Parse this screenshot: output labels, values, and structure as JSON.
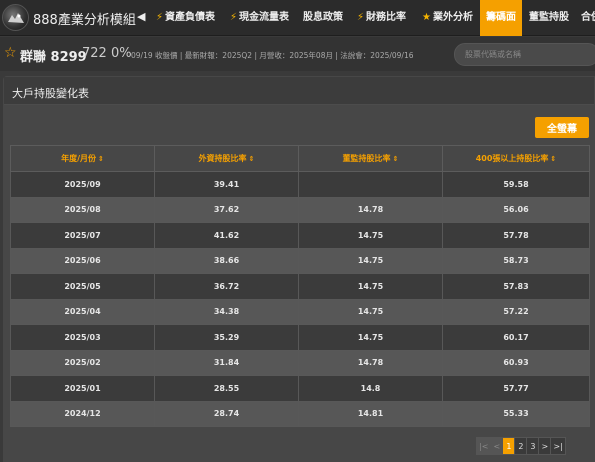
{
  "app": {
    "brand": "888產業分析模組"
  },
  "nav": {
    "arrow": "◀",
    "items": [
      {
        "label": "資產負債表",
        "bolt": true
      },
      {
        "label": "現金流量表",
        "bolt": true
      },
      {
        "label": "股息政策",
        "bolt": false
      },
      {
        "label": "財務比率",
        "bolt": true
      },
      {
        "label": "業外分析",
        "bolt": true,
        "star": true
      },
      {
        "label": "籌碼面",
        "bolt": false,
        "active": true
      },
      {
        "label": "董監持股",
        "bolt": false
      },
      {
        "label": "合併",
        "bolt": false
      }
    ]
  },
  "stock": {
    "name": "群聯 8299",
    "price": "722",
    "change": "0%",
    "meta": "09/19 收盤價 | 最新財報：2025Q2 | 月營收：2025年08月 | 法說會：2025/09/16",
    "search_placeholder": "股票代碼或名稱"
  },
  "panel": {
    "title": "大戶持股變化表",
    "fullscreen_label": "全螢幕"
  },
  "table": {
    "headers": [
      "年度/月份",
      "外資持股比率",
      "董監持股比率",
      "400張以上持股比率"
    ],
    "sort_icon": "⇕",
    "rows": [
      [
        "2025/09",
        "39.41",
        "",
        "59.58"
      ],
      [
        "2025/08",
        "37.62",
        "14.78",
        "56.06"
      ],
      [
        "2025/07",
        "41.62",
        "14.75",
        "57.78"
      ],
      [
        "2025/06",
        "38.66",
        "14.75",
        "58.73"
      ],
      [
        "2025/05",
        "36.72",
        "14.75",
        "57.83"
      ],
      [
        "2025/04",
        "34.38",
        "14.75",
        "57.22"
      ],
      [
        "2025/03",
        "35.29",
        "14.75",
        "60.17"
      ],
      [
        "2025/02",
        "31.84",
        "14.78",
        "60.93"
      ],
      [
        "2025/01",
        "28.55",
        "14.8",
        "57.77"
      ],
      [
        "2024/12",
        "28.74",
        "14.81",
        "55.33"
      ]
    ]
  },
  "pager": {
    "first": "|<",
    "prev": "<",
    "pages": [
      "1",
      "2",
      "3"
    ],
    "current": "1",
    "next": ">",
    "last": ">|"
  }
}
